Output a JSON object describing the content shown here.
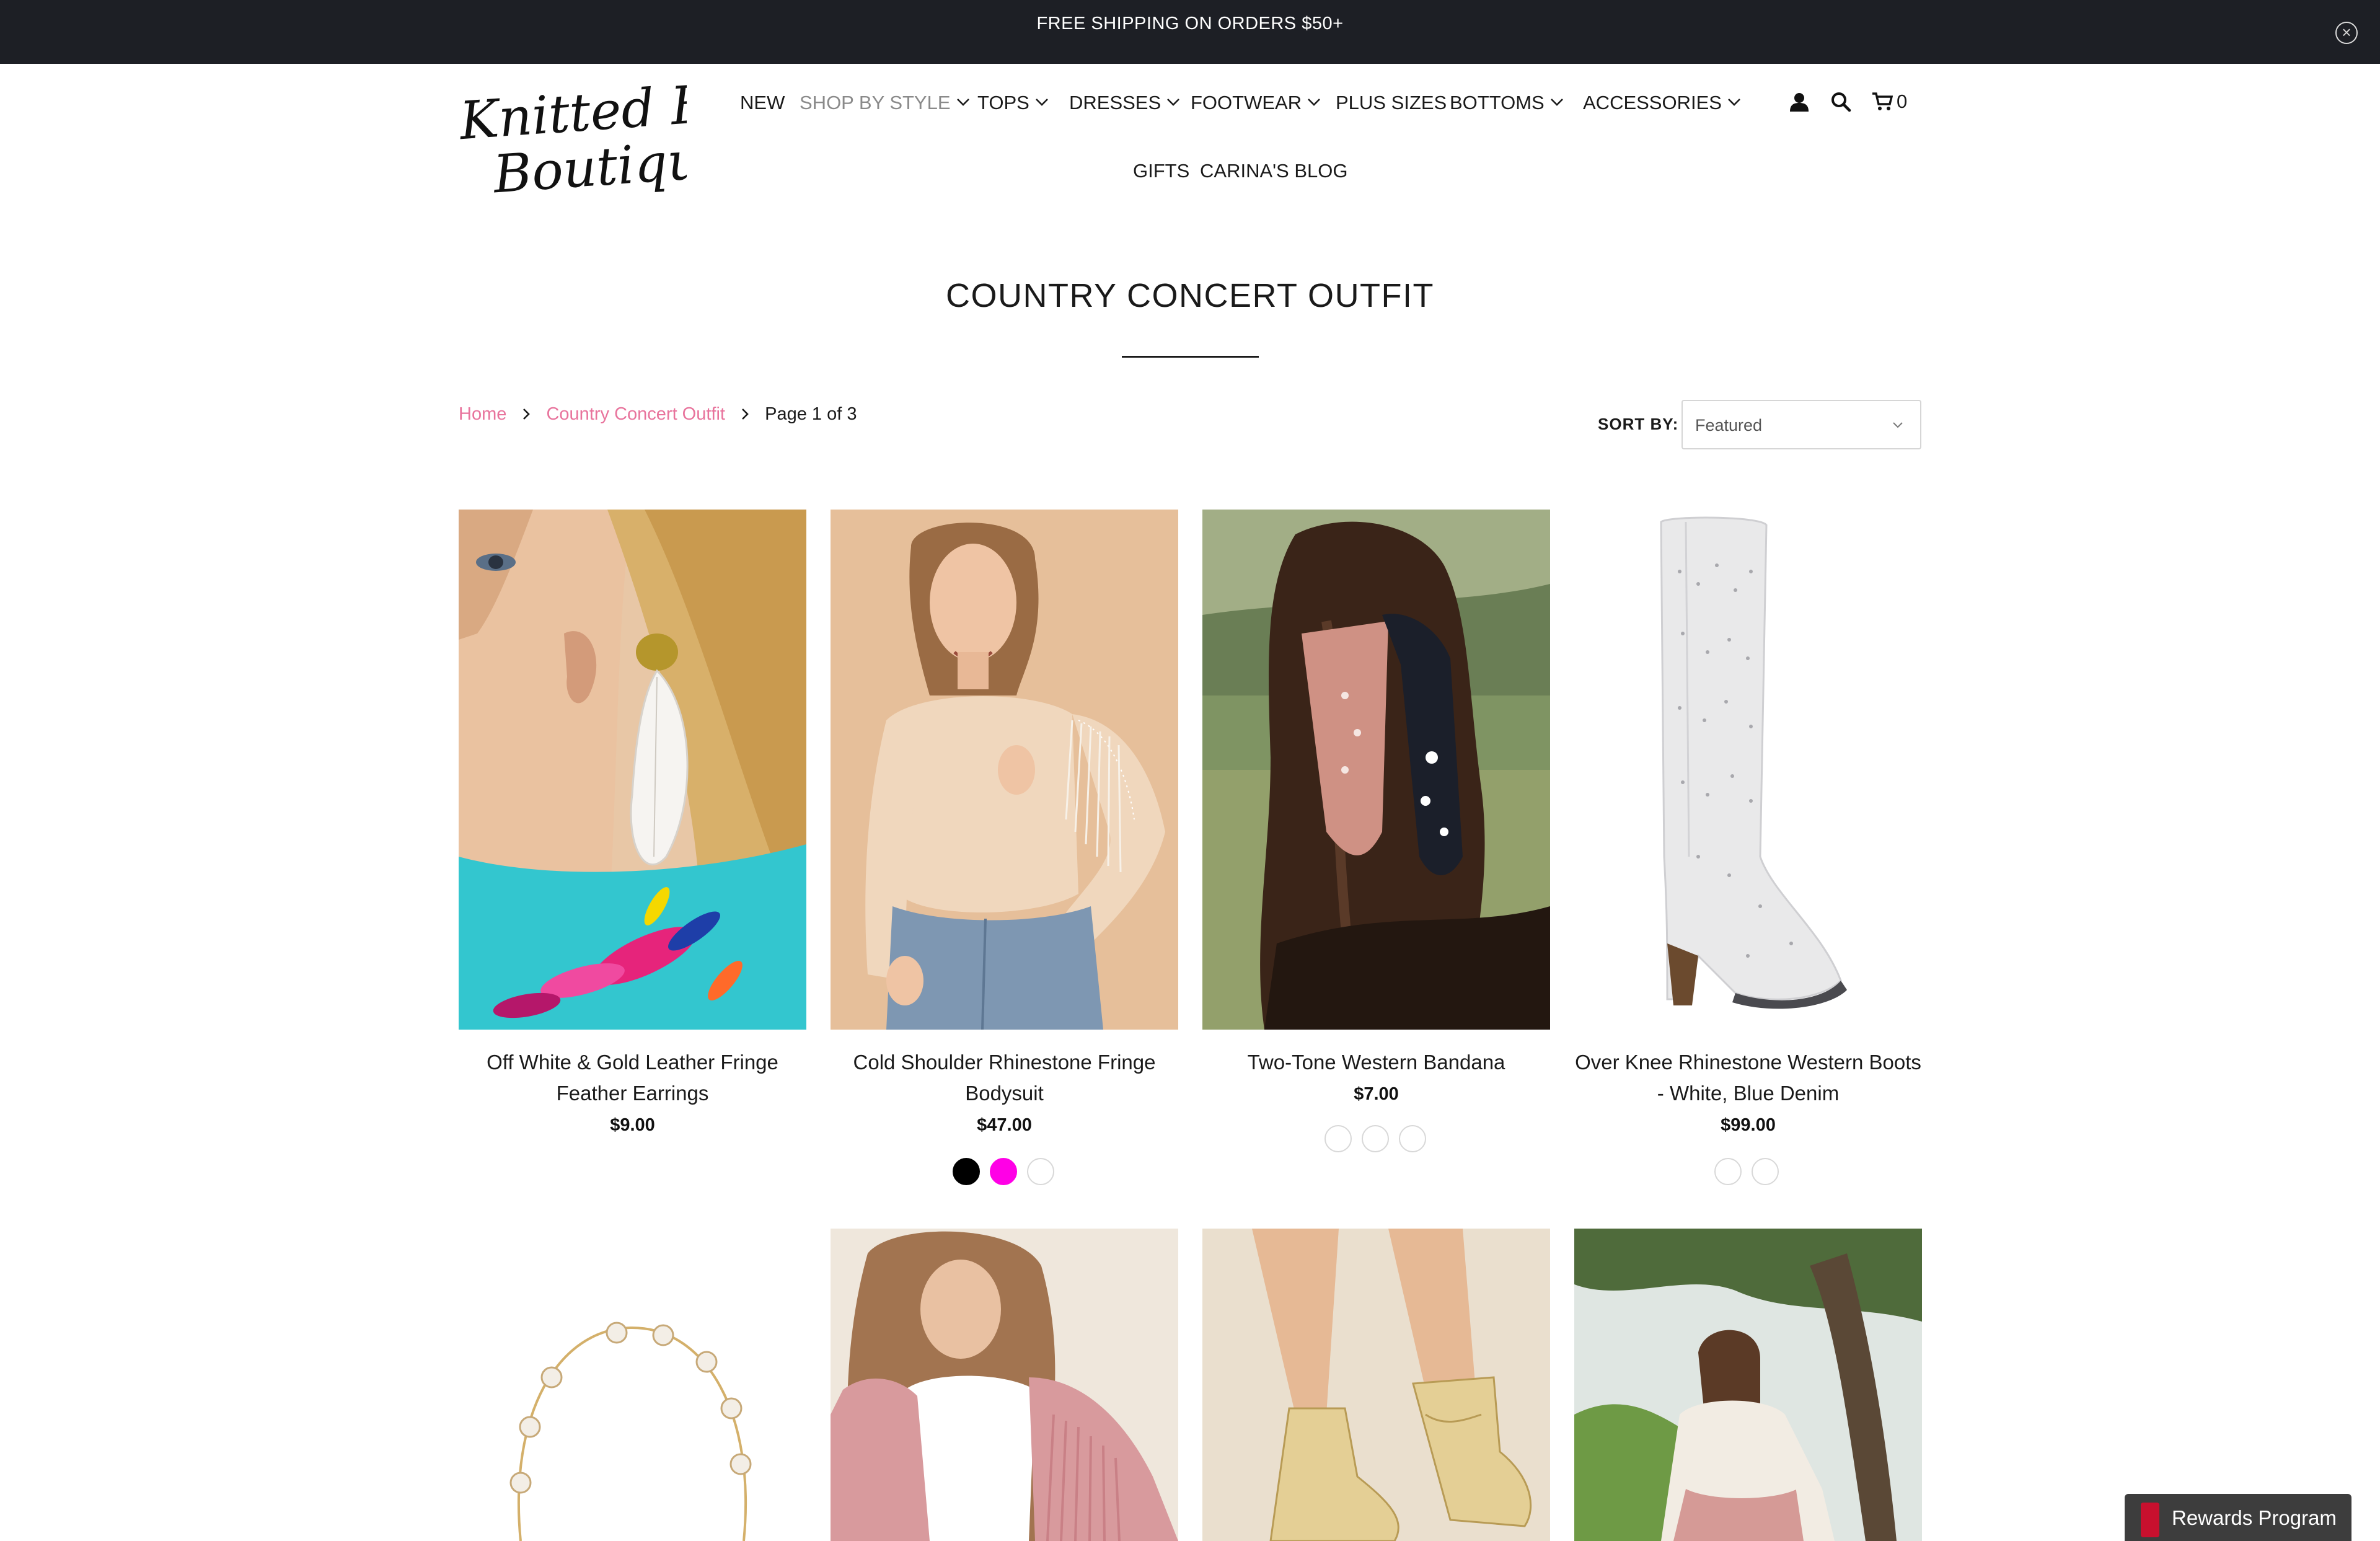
{
  "announcement": {
    "text": "FREE SHIPPING ON ORDERS $50+",
    "close_icon": "close-circle-icon"
  },
  "brand": {
    "logo_line1": "Knitted Belle",
    "logo_line2": "Boutique"
  },
  "nav": {
    "items": [
      {
        "label": "NEW",
        "dropdown": false
      },
      {
        "label": "SHOP BY STYLE",
        "dropdown": true,
        "active": true
      },
      {
        "label": "TOPS",
        "dropdown": true
      },
      {
        "label": "DRESSES",
        "dropdown": true
      },
      {
        "label": "FOOTWEAR",
        "dropdown": true
      },
      {
        "label": "PLUS SIZES",
        "dropdown": false
      },
      {
        "label": "BOTTOMS",
        "dropdown": true
      },
      {
        "label": "ACCESSORIES",
        "dropdown": true
      },
      {
        "label": "GIFTS",
        "dropdown": false
      },
      {
        "label": "CARINA'S BLOG",
        "dropdown": false
      }
    ],
    "icons": [
      "account-icon",
      "search-icon",
      "cart-icon"
    ],
    "cart_count": "0"
  },
  "page": {
    "title": "COUNTRY CONCERT OUTFIT"
  },
  "breadcrumb": {
    "home": "Home",
    "collection": "Country Concert Outfit",
    "current": "Page 1 of 3"
  },
  "sort": {
    "label": "SORT BY:",
    "value": "Featured"
  },
  "products": [
    {
      "title_line1": "Off White & Gold Leather Fringe",
      "title_line2": "Feather Earrings",
      "price": "$9.00",
      "swatches": []
    },
    {
      "title_line1": "Cold Shoulder Rhinestone Fringe",
      "title_line2": "Bodysuit",
      "price": "$47.00",
      "swatches": [
        "#000000",
        "#ff00e6",
        "#ffffff"
      ]
    },
    {
      "title_line1": "Two-Tone Western Bandana",
      "title_line2": "",
      "price": "$7.00",
      "swatches": [
        "#ffffff",
        "#ffffff",
        "#ffffff"
      ]
    },
    {
      "title_line1": "Over Knee Rhinestone Western Boots",
      "title_line2": "- White, Blue Denim",
      "price": "$99.00",
      "swatches": [
        "#ffffff",
        "#ffffff"
      ]
    }
  ],
  "rewards": {
    "label": "Rewards Program"
  },
  "colors": {
    "announcement_bg": "#1d1f25",
    "link_pink": "#e8739c",
    "nav_active_grey": "#8a8a8a"
  }
}
